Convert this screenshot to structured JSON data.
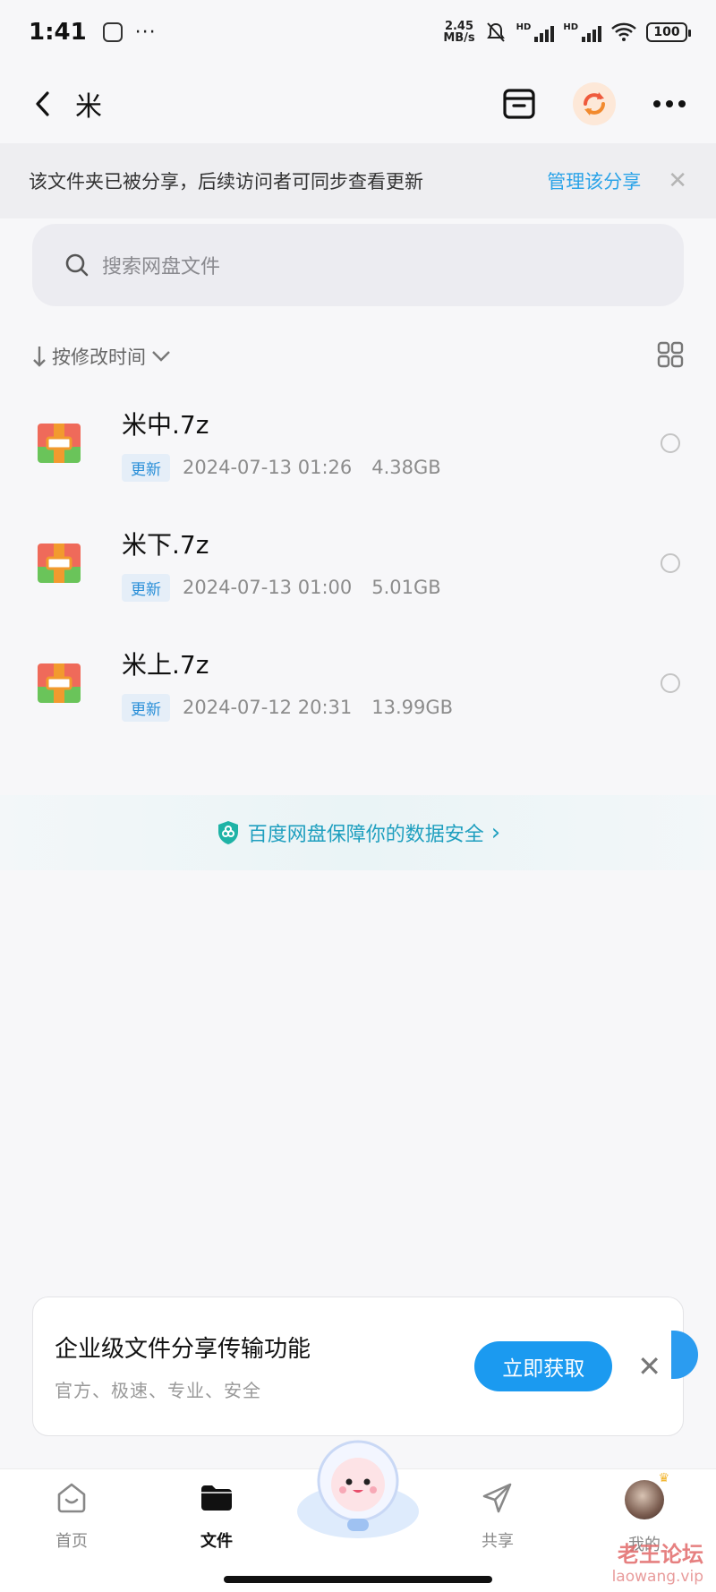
{
  "status_bar": {
    "time": "1:41",
    "more_dots": "···",
    "speed_value": "2.45",
    "speed_unit": "MB/s",
    "hd_label": "HD",
    "battery": "100"
  },
  "nav": {
    "title": "米"
  },
  "share_banner": {
    "text": "该文件夹已被分享，后续访问者可同步查看更新",
    "link": "管理该分享",
    "close": "✕"
  },
  "search": {
    "placeholder": "搜索网盘文件"
  },
  "sort": {
    "label": "按修改时间"
  },
  "files": [
    {
      "name": "米中.7z",
      "tag": "更新",
      "date": "2024-07-13  01:26",
      "size": "4.38GB"
    },
    {
      "name": "米下.7z",
      "tag": "更新",
      "date": "2024-07-13  01:00",
      "size": "5.01GB"
    },
    {
      "name": "米上.7z",
      "tag": "更新",
      "date": "2024-07-12  20:31",
      "size": "13.99GB"
    }
  ],
  "safety": {
    "text": "百度网盘保障你的数据安全",
    "arrow": "›"
  },
  "promo": {
    "title": "企业级文件分享传输功能",
    "subtitle": "官方、极速、专业、安全",
    "button": "立即获取",
    "close": "✕"
  },
  "tabs": [
    {
      "label": "首页"
    },
    {
      "label": "文件"
    },
    {
      "label": "共享"
    },
    {
      "label": "我的"
    }
  ],
  "watermark": {
    "title": "老王论坛",
    "sub": "laowang.vip"
  },
  "colors": {
    "accent": "#1b9af0",
    "link": "#2aa3e8",
    "safety": "#1f9fbf",
    "tag_bg": "#e5eef8"
  }
}
